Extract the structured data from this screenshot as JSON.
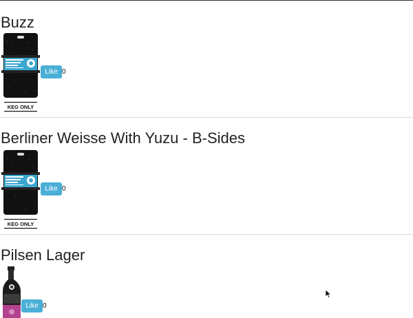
{
  "beers": [
    {
      "name": "Buzz",
      "like_label": "Like",
      "likes": "0",
      "image": "keg-only-icon",
      "image_text": "KEG ONLY"
    },
    {
      "name": "Berliner Weisse With Yuzu - B-Sides",
      "like_label": "Like",
      "likes": "0",
      "image": "keg-only-icon",
      "image_text": "KEG ONLY"
    },
    {
      "name": "Pilsen Lager",
      "like_label": "Like",
      "likes": "0",
      "image": "bottle-icon"
    }
  ],
  "colors": {
    "like_button": "#4aafd6",
    "label_blue": "#3aa7cf",
    "bottle_label": "#b3428f"
  }
}
